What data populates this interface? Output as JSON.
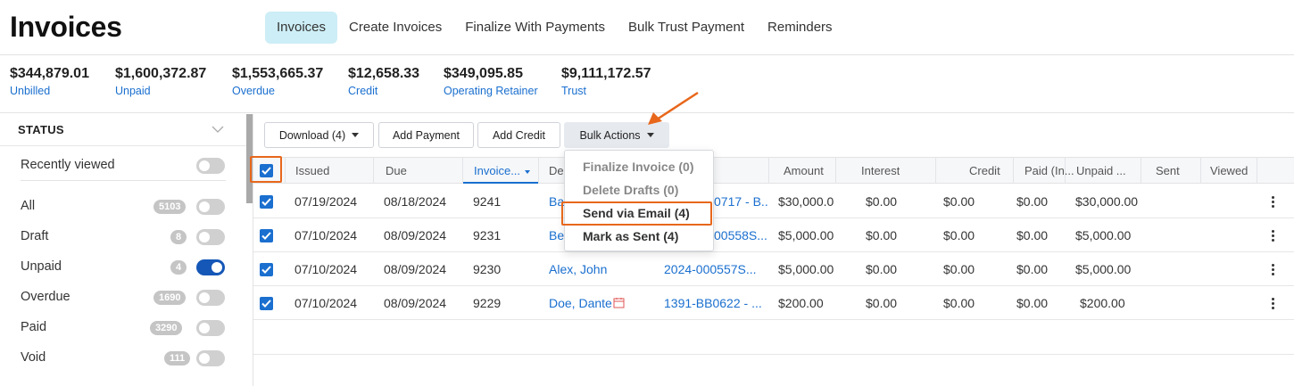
{
  "page": {
    "title": "Invoices"
  },
  "nav": {
    "tabs": [
      {
        "label": "Invoices",
        "active": true
      },
      {
        "label": "Create Invoices"
      },
      {
        "label": "Finalize With Payments"
      },
      {
        "label": "Bulk Trust Payment"
      },
      {
        "label": "Reminders"
      }
    ]
  },
  "summary": [
    {
      "amount": "$344,879.01",
      "label": "Unbilled"
    },
    {
      "amount": "$1,600,372.87",
      "label": "Unpaid"
    },
    {
      "amount": "$1,553,665.37",
      "label": "Overdue"
    },
    {
      "amount": "$12,658.33",
      "label": "Credit"
    },
    {
      "amount": "$349,095.85",
      "label": "Operating Retainer"
    },
    {
      "amount": "$9,111,172.57",
      "label": "Trust"
    }
  ],
  "sidebar": {
    "heading": "STATUS",
    "recently_viewed": {
      "label": "Recently viewed",
      "on": false
    },
    "filters": [
      {
        "label": "All",
        "count": "5103",
        "on": false
      },
      {
        "label": "Draft",
        "count": "8",
        "on": false
      },
      {
        "label": "Unpaid",
        "count": "4",
        "on": true
      },
      {
        "label": "Overdue",
        "count": "1690",
        "on": false
      },
      {
        "label": "Paid",
        "count": "3290",
        "on": false
      },
      {
        "label": "Void",
        "count": "111",
        "on": false
      }
    ]
  },
  "toolbar": {
    "download": "Download (4)",
    "add_payment": "Add Payment",
    "add_credit": "Add Credit",
    "bulk_actions": "Bulk Actions"
  },
  "bulk_menu": [
    {
      "label": "Finalize Invoice (0)",
      "enabled": false
    },
    {
      "label": "Delete Drafts (0)",
      "enabled": false
    },
    {
      "label": "Send via Email (4)",
      "enabled": true,
      "highlighted": true
    },
    {
      "label": "Mark as Sent (4)",
      "enabled": true
    }
  ],
  "table": {
    "columns": [
      "Issued",
      "Due",
      "Invoice...",
      "De",
      "",
      "Amount",
      "Interest",
      "Credit",
      "Paid (In...",
      "Unpaid ...",
      "Sent",
      "Viewed"
    ],
    "rows": [
      {
        "checked": true,
        "issued": "07/19/2024",
        "due": "08/18/2024",
        "invoice": "9241",
        "client": "Ba",
        "matter": "0717 - B...",
        "amount": "$30,000.0",
        "interest": "$0.00",
        "credit": "$0.00",
        "paid": "$0.00",
        "unpaid": "$30,000.00"
      },
      {
        "checked": true,
        "issued": "07/10/2024",
        "due": "08/09/2024",
        "invoice": "9231",
        "client": "Be",
        "matter": "00558S...",
        "amount": "$5,000.00",
        "interest": "$0.00",
        "credit": "$0.00",
        "paid": "$0.00",
        "unpaid": "$5,000.00"
      },
      {
        "checked": true,
        "issued": "07/10/2024",
        "due": "08/09/2024",
        "invoice": "9230",
        "client": "Alex, John",
        "matter": "2024-000557S...",
        "amount": "$5,000.00",
        "interest": "$0.00",
        "credit": "$0.00",
        "paid": "$0.00",
        "unpaid": "$5,000.00"
      },
      {
        "checked": true,
        "issued": "07/10/2024",
        "due": "08/09/2024",
        "invoice": "9229",
        "client": "Doe, Dante",
        "matter": "1391-BB0622 - ...",
        "amount": "$200.00",
        "interest": "$0.00",
        "credit": "$0.00",
        "paid": "$0.00",
        "unpaid": "$200.00"
      }
    ]
  },
  "colors": {
    "accent": "#1a6fcf",
    "highlight": "#e8671b",
    "active_tab": "#cdeef6",
    "toggle_on": "#1557b7"
  }
}
